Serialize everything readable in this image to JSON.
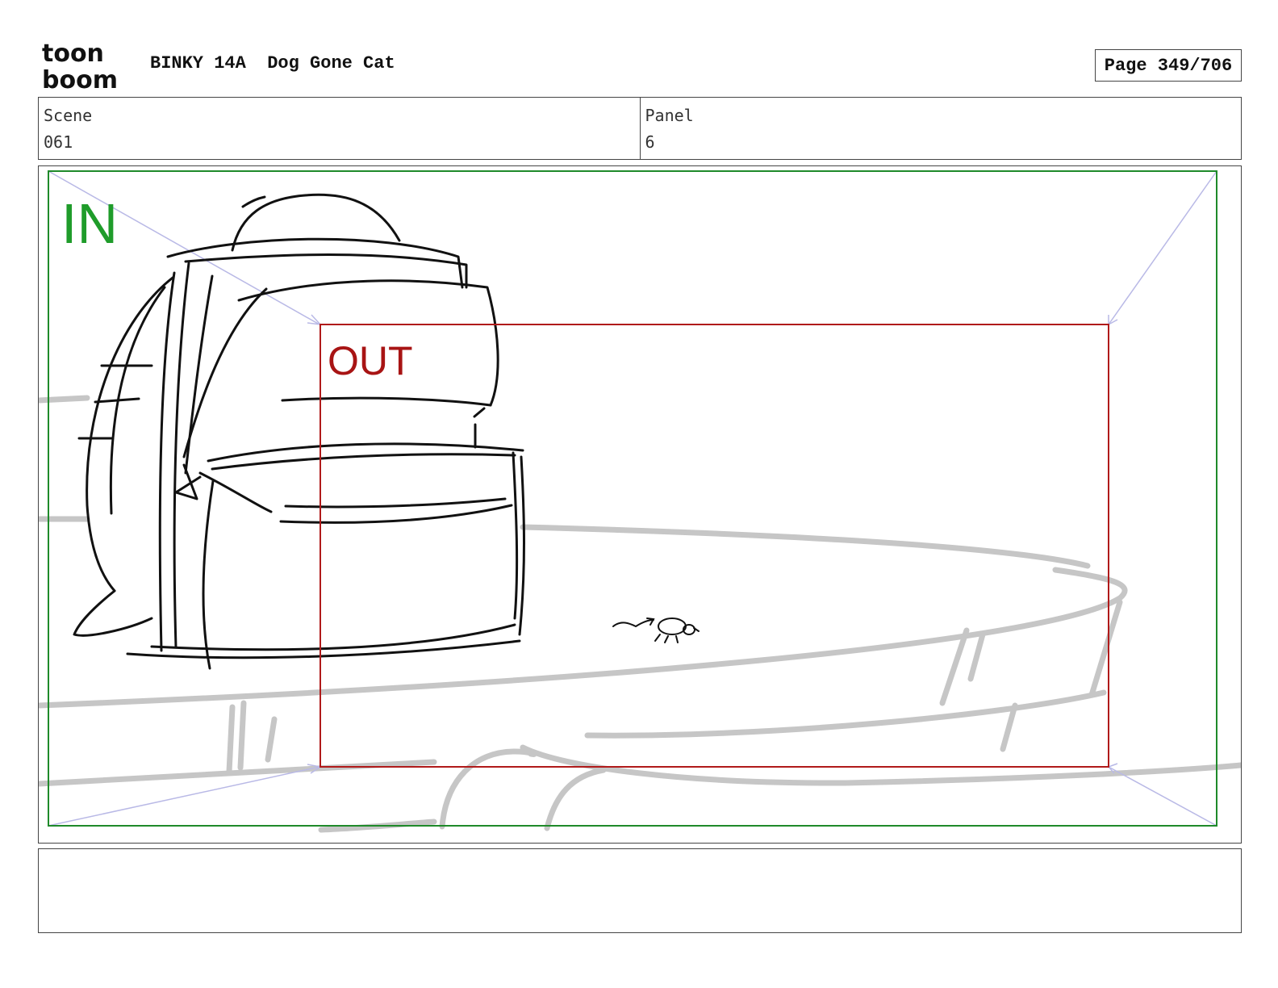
{
  "header": {
    "logo_text_line1": "toon",
    "logo_text_line2": "boom",
    "production": "BINKY 14A",
    "episode": "Dog Gone Cat",
    "page_label": "Page 349/706"
  },
  "info": {
    "scene_label": "Scene",
    "scene_value": "061",
    "panel_label": "Panel",
    "panel_value": "6"
  },
  "frame": {
    "in_label": "IN",
    "out_label": "OUT"
  },
  "colors": {
    "in_frame": "#1f8a2a",
    "out_frame": "#b01a1a",
    "camera_arrows": "#b9b9e6",
    "sketch_ink": "#111111",
    "rough_lines": "#c6c6c6"
  },
  "notes": {
    "text": ""
  }
}
